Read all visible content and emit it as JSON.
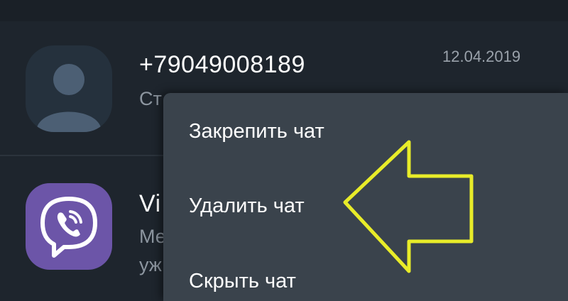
{
  "chats": [
    {
      "name": "+79049008189",
      "preview": "Ст",
      "date": "12.04.2019",
      "avatar_icon": "person-icon"
    },
    {
      "name": "Vi",
      "preview_lines": [
        "Ме",
        "уж"
      ],
      "avatar_icon": "viber-icon"
    }
  ],
  "context_menu": {
    "items": [
      {
        "label": "Закрепить чат"
      },
      {
        "label": "Удалить чат"
      },
      {
        "label": "Скрыть чат"
      }
    ]
  },
  "highlight": {
    "icon": "arrow-left-icon",
    "color": "#e8ec29"
  }
}
